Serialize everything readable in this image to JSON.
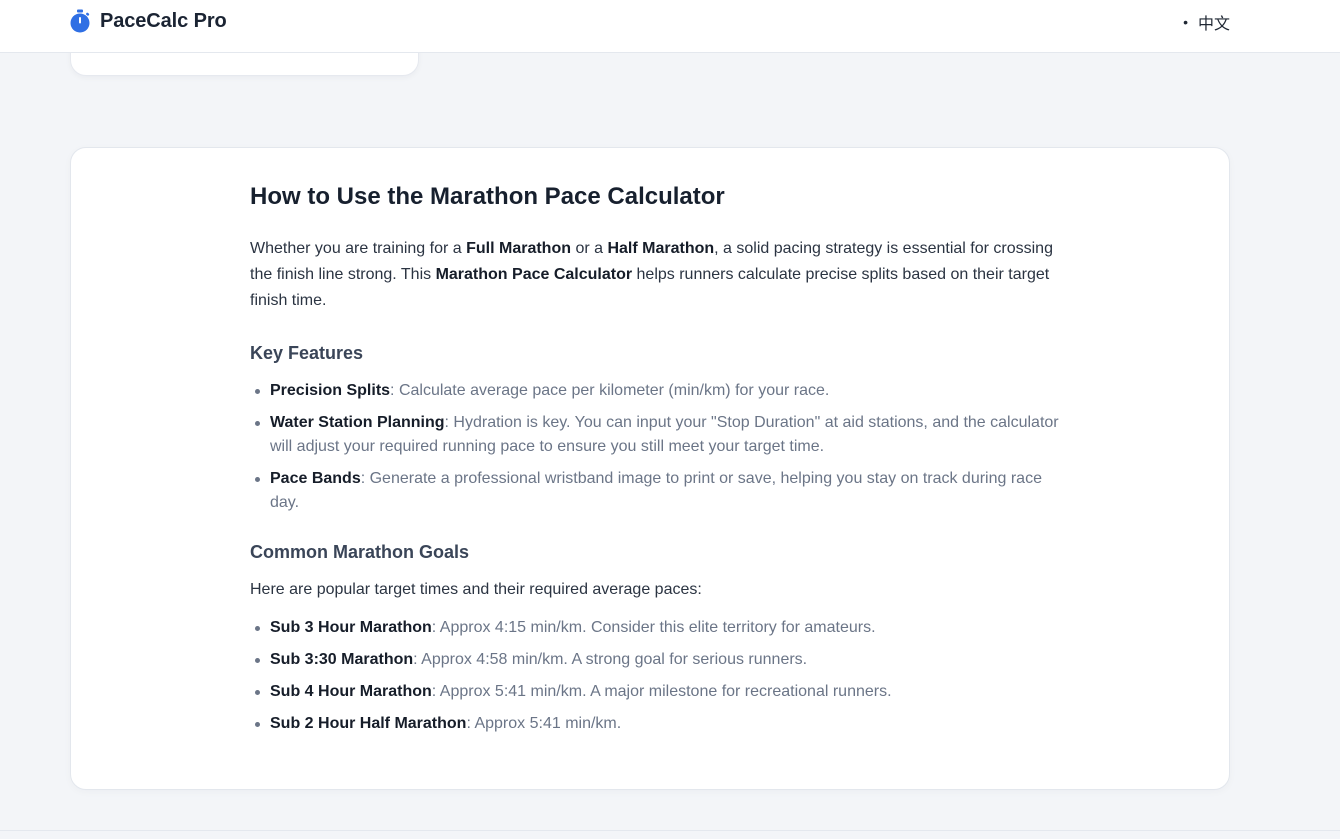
{
  "header": {
    "brand_name": "PaceCalc Pro",
    "brand_icon": "stopwatch-icon",
    "brand_color": "#2f6fe4",
    "lang_switch_label": "中文"
  },
  "article": {
    "title": "How to Use the Marathon Pace Calculator",
    "intro": {
      "t1": "Whether you are training for a ",
      "b1": "Full Marathon",
      "t2": " or a ",
      "b2": "Half Marathon",
      "t3": ", a solid pacing strategy is essential for crossing the finish line strong. This ",
      "b3": "Marathon Pace Calculator",
      "t4": " helps runners calculate precise splits based on their target finish time."
    },
    "features": {
      "heading": "Key Features",
      "items": [
        {
          "name": "Precision Splits",
          "desc": ": Calculate average pace per kilometer (min/km) for your race."
        },
        {
          "name": "Water Station Planning",
          "desc": ": Hydration is key. You can input your \"Stop Duration\" at aid stations, and the calculator will adjust your required running pace to ensure you still meet your target time."
        },
        {
          "name": "Pace Bands",
          "desc": ": Generate a professional wristband image to print or save, helping you stay on track during race day."
        }
      ]
    },
    "goals": {
      "heading": "Common Marathon Goals",
      "intro": "Here are popular target times and their required average paces:",
      "items": [
        {
          "name": "Sub 3 Hour Marathon",
          "desc": ": Approx 4:15 min/km. Consider this elite territory for amateurs."
        },
        {
          "name": "Sub 3:30 Marathon",
          "desc": ": Approx 4:58 min/km. A strong goal for serious runners."
        },
        {
          "name": "Sub 4 Hour Marathon",
          "desc": ": Approx 5:41 min/km. A major milestone for recreational runners."
        },
        {
          "name": "Sub 2 Hour Half Marathon",
          "desc": ": Approx 5:41 min/km."
        }
      ]
    }
  }
}
